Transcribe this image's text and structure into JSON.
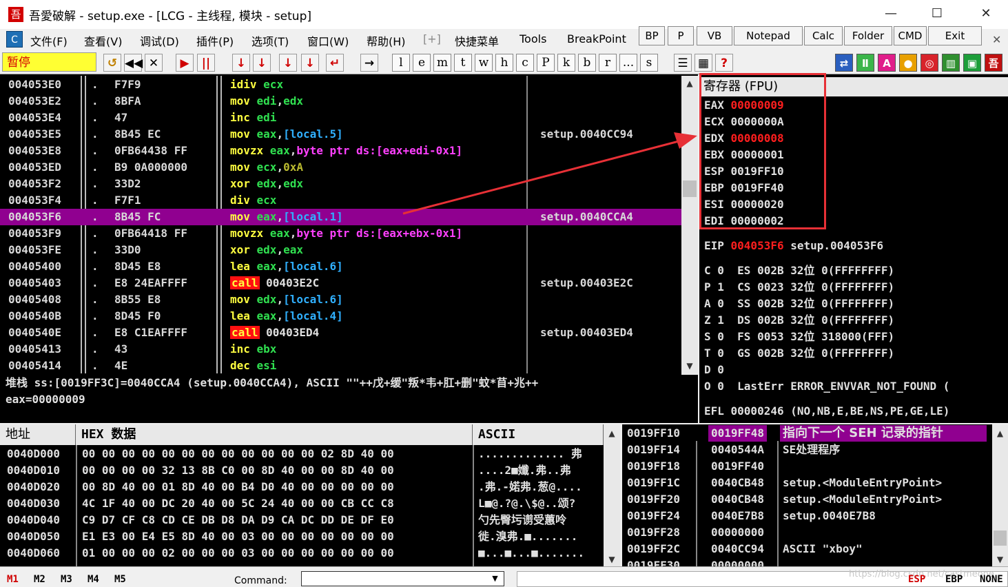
{
  "window": {
    "title": "吾愛破解 - setup.exe - [LCG -  主线程, 模块 - setup]",
    "icon": "吾",
    "minimize": "—",
    "maximize": "☐",
    "close": "✕"
  },
  "menu": {
    "icon": "C",
    "items": [
      "文件(F)",
      "查看(V)",
      "调试(D)",
      "插件(P)",
      "选项(T)",
      "窗口(W)",
      "帮助(H)",
      "[+]",
      "快捷菜单",
      "Tools",
      "BreakPoint"
    ],
    "plugin_buttons": [
      "BP",
      "P",
      "VB",
      "Notepad",
      "Calc",
      "Folder",
      "CMD",
      "Exit"
    ],
    "close": "✕"
  },
  "toolbar": {
    "status": "暂停",
    "nav_buttons": [
      "↺",
      "◀◀",
      "✕",
      "▶",
      "||",
      "↓",
      "↓",
      "↓",
      "↓",
      "↵",
      "→"
    ],
    "letter_buttons": [
      "l",
      "e",
      "m",
      "t",
      "w",
      "h",
      "c",
      "P",
      "k",
      "b",
      "r",
      "...",
      "s"
    ],
    "extra_buttons": [
      "☰",
      "▦",
      "?"
    ],
    "color_icons": [
      {
        "glyph": "⇄",
        "color": "#2a5fbf"
      },
      {
        "glyph": "Ⅱ",
        "color": "#3bb54a"
      },
      {
        "glyph": "A",
        "color": "#e01e8a"
      },
      {
        "glyph": "●",
        "color": "#e8a000"
      },
      {
        "glyph": "◎",
        "color": "#d8232a"
      },
      {
        "glyph": "▥",
        "color": "#2f8f2f"
      },
      {
        "glyph": "▣",
        "color": "#1d9e3a"
      },
      {
        "glyph": "吾",
        "color": "#c01010"
      }
    ]
  },
  "disasm": [
    {
      "addr": "004053E0",
      "dot": ".",
      "hex": "F7F9",
      "asm": [
        [
          "op",
          "idiv "
        ],
        [
          "reg",
          "ecx"
        ]
      ],
      "cmt": ""
    },
    {
      "addr": "004053E2",
      "dot": ".",
      "hex": "8BFA",
      "asm": [
        [
          "op",
          "mov "
        ],
        [
          "reg",
          "edi"
        ],
        [
          "txt",
          ","
        ],
        [
          "reg",
          "edx"
        ]
      ],
      "cmt": ""
    },
    {
      "addr": "004053E4",
      "dot": ".",
      "hex": "47",
      "asm": [
        [
          "op",
          "inc "
        ],
        [
          "reg",
          "edi"
        ]
      ],
      "cmt": ""
    },
    {
      "addr": "004053E5",
      "dot": ".",
      "hex": "8B45 EC",
      "asm": [
        [
          "op",
          "mov "
        ],
        [
          "reg",
          "eax"
        ],
        [
          "txt",
          ","
        ],
        [
          "mem",
          "[local.5]"
        ]
      ],
      "cmt": "setup.0040CC94"
    },
    {
      "addr": "004053E8",
      "dot": ".",
      "hex": "0FB64438 FF",
      "asm": [
        [
          "op",
          "movzx "
        ],
        [
          "reg",
          "eax"
        ],
        [
          "txt",
          ","
        ],
        [
          "kw",
          "byte ptr ds:[eax+edi-0x1]"
        ]
      ],
      "cmt": ""
    },
    {
      "addr": "004053ED",
      "dot": ".",
      "hex": "B9 0A000000",
      "asm": [
        [
          "op",
          "mov "
        ],
        [
          "reg",
          "ecx"
        ],
        [
          "txt",
          ","
        ],
        [
          "imm",
          "0xA"
        ]
      ],
      "cmt": ""
    },
    {
      "addr": "004053F2",
      "dot": ".",
      "hex": "33D2",
      "asm": [
        [
          "op",
          "xor "
        ],
        [
          "reg",
          "edx"
        ],
        [
          "txt",
          ","
        ],
        [
          "reg",
          "edx"
        ]
      ],
      "cmt": ""
    },
    {
      "addr": "004053F4",
      "dot": ".",
      "hex": "F7F1",
      "asm": [
        [
          "op",
          "div "
        ],
        [
          "reg",
          "ecx"
        ]
      ],
      "cmt": ""
    },
    {
      "addr": "004053F6",
      "dot": ".",
      "hex": "8B45 FC",
      "asm": [
        [
          "op",
          "mov "
        ],
        [
          "reg",
          "eax"
        ],
        [
          "txt",
          ","
        ],
        [
          "mem",
          "[local.1]"
        ]
      ],
      "cmt": "setup.0040CCA4",
      "selected": true
    },
    {
      "addr": "004053F9",
      "dot": ".",
      "hex": "0FB64418 FF",
      "asm": [
        [
          "op",
          "movzx "
        ],
        [
          "reg",
          "eax"
        ],
        [
          "txt",
          ","
        ],
        [
          "kw",
          "byte ptr ds:[eax+ebx-0x1]"
        ]
      ],
      "cmt": ""
    },
    {
      "addr": "004053FE",
      "dot": ".",
      "hex": "33D0",
      "asm": [
        [
          "op",
          "xor "
        ],
        [
          "reg",
          "edx"
        ],
        [
          "txt",
          ","
        ],
        [
          "reg",
          "eax"
        ]
      ],
      "cmt": ""
    },
    {
      "addr": "00405400",
      "dot": ".",
      "hex": "8D45 E8",
      "asm": [
        [
          "op",
          "lea "
        ],
        [
          "reg",
          "eax"
        ],
        [
          "txt",
          ","
        ],
        [
          "mem",
          "[local.6]"
        ]
      ],
      "cmt": ""
    },
    {
      "addr": "00405403",
      "dot": ".",
      "hex": "E8 24EAFFFF",
      "asm": [
        [
          "call",
          "call"
        ],
        [
          "txt",
          " 00403E2C"
        ]
      ],
      "cmt": "setup.00403E2C"
    },
    {
      "addr": "00405408",
      "dot": ".",
      "hex": "8B55 E8",
      "asm": [
        [
          "op",
          "mov "
        ],
        [
          "reg",
          "edx"
        ],
        [
          "txt",
          ","
        ],
        [
          "mem",
          "[local.6]"
        ]
      ],
      "cmt": ""
    },
    {
      "addr": "0040540B",
      "dot": ".",
      "hex": "8D45 F0",
      "asm": [
        [
          "op",
          "lea "
        ],
        [
          "reg",
          "eax"
        ],
        [
          "txt",
          ","
        ],
        [
          "mem",
          "[local.4]"
        ]
      ],
      "cmt": ""
    },
    {
      "addr": "0040540E",
      "dot": ".",
      "hex": "E8 C1EAFFFF",
      "asm": [
        [
          "call",
          "call"
        ],
        [
          "txt",
          " 00403ED4"
        ]
      ],
      "cmt": "setup.00403ED4"
    },
    {
      "addr": "00405413",
      "dot": ".",
      "hex": "43",
      "asm": [
        [
          "op",
          "inc "
        ],
        [
          "reg",
          "ebx"
        ]
      ],
      "cmt": ""
    },
    {
      "addr": "00405414",
      "dot": ".",
      "hex": "4E",
      "asm": [
        [
          "op",
          "dec "
        ],
        [
          "reg",
          "esi"
        ]
      ],
      "cmt": ""
    }
  ],
  "info": {
    "line1": "堆栈 ss:[0019FF3C]=0040CCA4 (setup.0040CCA4), ASCII \"\"++戊+缓\"叛*韦+肛+删\"蚊*苜+兆++",
    "line2": "eax=00000009"
  },
  "registers": {
    "header": "寄存器 (FPU)",
    "general": [
      {
        "name": "EAX",
        "value": "00000009",
        "changed": true
      },
      {
        "name": "ECX",
        "value": "0000000A",
        "changed": false
      },
      {
        "name": "EDX",
        "value": "00000008",
        "changed": true
      },
      {
        "name": "EBX",
        "value": "00000001",
        "changed": false
      },
      {
        "name": "ESP",
        "value": "0019FF10",
        "changed": false
      },
      {
        "name": "EBP",
        "value": "0019FF40",
        "changed": false
      },
      {
        "name": "ESI",
        "value": "00000020",
        "changed": false
      },
      {
        "name": "EDI",
        "value": "00000002",
        "changed": false
      }
    ],
    "eip": {
      "name": "EIP",
      "value": "004053F6",
      "comment": "setup.004053F6"
    },
    "flags": [
      "C 0  ES 002B 32位 0(FFFFFFFF)",
      "P 1  CS 0023 32位 0(FFFFFFFF)",
      "A 0  SS 002B 32位 0(FFFFFFFF)",
      "Z 1  DS 002B 32位 0(FFFFFFFF)",
      "S 0  FS 0053 32位 318000(FFF)",
      "T 0  GS 002B 32位 0(FFFFFFFF)",
      "D 0",
      "O 0  LastErr ERROR_ENVVAR_NOT_FOUND ("
    ],
    "efl": "EFL 00000246 (NO,NB,E,BE,NS,PE,GE,LE)"
  },
  "dump": {
    "headers": {
      "addr": "地址",
      "hex": "HEX 数据",
      "ascii": "ASCII"
    },
    "rows": [
      {
        "addr": "0040D000",
        "hex": "00 00 00 00|00 00 00 00|00 00 00 00|02 8D 40 00",
        "ascii": "............. 弗"
      },
      {
        "addr": "0040D010",
        "hex": "00 00 00 00|32 13 8B C0|00 8D 40 00|00 8D 40 00",
        "ascii": "....2■孅.弗..弗"
      },
      {
        "addr": "0040D020",
        "hex": "00 8D 40 00|01 8D 40 00|B4 D0 40 00|00 00 00 00",
        "ascii": ".弗.-婼弗.葱@...."
      },
      {
        "addr": "0040D030",
        "hex": "4C 1F 40 00|DC 20 40 00|5C 24 40 00|00 CB CC C8",
        "ascii": "L■@.?@.\\$@..颂?"
      },
      {
        "addr": "0040D040",
        "hex": "C9 D7 CF C8|CD CE DB D8|DA D9 CA DC|DD DE DF E0",
        "ascii": "勺先臀圬谫受蕙呤"
      },
      {
        "addr": "0040D050",
        "hex": "E1 E3 00 E4|E5 8D 40 00|03 00 00 00|00 00 00 00",
        "ascii": "徙.溴弗.■......."
      },
      {
        "addr": "0040D060",
        "hex": "01 00 00 00|02 00 00 00|03 00 00 00|00 00 00 00",
        "ascii": "■...■...■......."
      }
    ]
  },
  "stack": {
    "header": {
      "addr": "0019FF10",
      "value": "0019FF48",
      "comment": "指向下一个 SEH 记录的指针"
    },
    "rows": [
      {
        "addr": "0019FF14",
        "value": "0040544A",
        "comment": "SE处理程序"
      },
      {
        "addr": "0019FF18",
        "value": "0019FF40",
        "comment": ""
      },
      {
        "addr": "0019FF1C",
        "value": "0040CB48",
        "comment": "setup.<ModuleEntryPoint>"
      },
      {
        "addr": "0019FF20",
        "value": "0040CB48",
        "comment": "setup.<ModuleEntryPoint>"
      },
      {
        "addr": "0019FF24",
        "value": "0040E7B8",
        "comment": "setup.0040E7B8"
      },
      {
        "addr": "0019FF28",
        "value": "00000000",
        "comment": ""
      },
      {
        "addr": "0019FF2C",
        "value": "0040CC94",
        "comment": "ASCII \"xboy\""
      },
      {
        "addr": "0019FF30",
        "value": "00000000",
        "comment": ""
      }
    ]
  },
  "statusbar": {
    "tabs": [
      "M1",
      "M2",
      "M3",
      "M4",
      "M5"
    ],
    "command_label": "Command:",
    "command_value": "",
    "watermark": "https://blog.csdn.net/castmeone",
    "stack_tags": [
      "ESP",
      "EBP",
      "NONE"
    ]
  },
  "colors": {
    "accent_red": "#e73036",
    "selection": "#900090",
    "changed_reg": "#ff1e1e"
  }
}
